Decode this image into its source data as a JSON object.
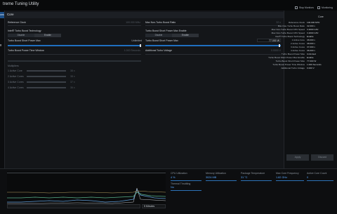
{
  "titlebar": {
    "title": "treme Tuning Utility",
    "stop_monitors_label": "Stop Monitors",
    "monitoring_label": "Monitoring"
  },
  "nav": {
    "items": [
      {
        "label": "ons",
        "active": true
      },
      {
        "label": "g",
        "active": false
      }
    ]
  },
  "main": {
    "tab_label": "Core",
    "reference_clock": {
      "label": "Reference Clock",
      "value": "100.000 MHz"
    },
    "max_non_turbo": {
      "label": "Max Non-Turbo Boost Ratio",
      "value": "32 x"
    },
    "turbo_boost_tech": {
      "label": "Intel® Turbo Boost Technology",
      "disable": "Disable",
      "enable": "Enable"
    },
    "short_power_max_enable": {
      "label": "Turbo Boost Short Power Max Enable",
      "disable": "Disable",
      "enable": "Enable"
    },
    "short_power_max": {
      "label": "Turbo Boost Short Power Max",
      "value": "Unlimited"
    },
    "short_power_max_right": {
      "label": "Turbo Boost Short Power Max",
      "value": "77.000 W"
    },
    "power_time_window": {
      "label": "Turbo Boost Power Time Window",
      "value": "1.000 Seconds"
    },
    "additional_voltage": {
      "label": "Additional Turbo Voltage",
      "value": "0.0000 V"
    },
    "multipliers": {
      "header": "Multipliers",
      "rows": [
        {
          "label": "1 Active Core",
          "value": "38 x"
        },
        {
          "label": "2 Active Cores",
          "value": "38 x"
        },
        {
          "label": "3 Active Cores",
          "value": "37 x"
        },
        {
          "label": "4 Active Cores",
          "value": "36 x"
        }
      ]
    }
  },
  "right_panel": {
    "title": "Core",
    "rows": [
      {
        "label": "Reference Clock",
        "value": "100.000 MHz"
      },
      {
        "label": "Max Non-Turbo Boost Ratio",
        "value": "32.000 x"
      },
      {
        "label": "Max Non-Turbo Boost CPU Speed",
        "value": "3.2000 GHz"
      },
      {
        "label": "Max Non-Turbo Boost CPU Speed",
        "value": "3.2000 GHz"
      },
      {
        "label": "Intel® Turbo Boost Technology",
        "value": "Enable"
      },
      {
        "label": "1 Active Core",
        "value": "38.000 x"
      },
      {
        "label": "2 Active Cores",
        "value": "38.000 x"
      },
      {
        "label": "3 Active Cores",
        "value": "37.000 x"
      },
      {
        "label": "4 Active Cores",
        "value": "36.000 x"
      },
      {
        "label": "Turbo Boost Power Max",
        "value": "Unlimited"
      },
      {
        "label": "Turbo Boost Short Power Max Enable",
        "value": "Enable"
      },
      {
        "label": "Turbo Boost Short Power Max",
        "value": "77.000 W"
      },
      {
        "label": "Turbo Boost Power Time Window",
        "value": "1.000 Seconds"
      },
      {
        "label": "Additional Turbo Voltage",
        "value": "0.000 V"
      }
    ],
    "apply_label": "Apply",
    "discard_label": "Discard"
  },
  "monitor": {
    "dropdown_value": "",
    "interval_value": "5 Minutes",
    "stats": [
      {
        "label": "CPU Utilization",
        "value": "4 %"
      },
      {
        "label": "Memory Utilization",
        "value": "3024 MB"
      },
      {
        "label": "Package Temperature",
        "value": "31 °C"
      },
      {
        "label": "Max Core Frequency",
        "value": "1.82 GHz"
      },
      {
        "label": "Active Core Count",
        "value": "0"
      }
    ],
    "thermal_throttling": {
      "label": "Thermal Throttling",
      "value": "No"
    }
  }
}
